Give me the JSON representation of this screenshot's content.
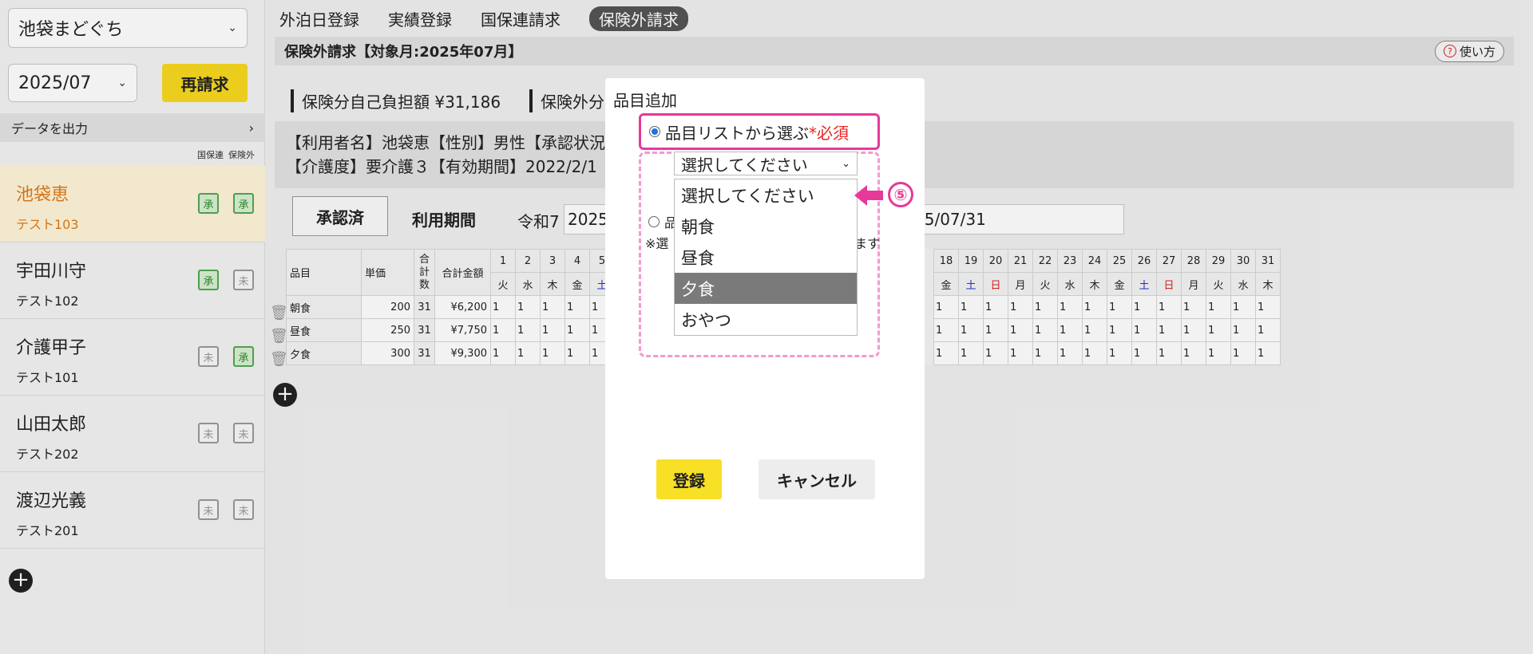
{
  "sidebar": {
    "facility": "池袋まどぐち",
    "month": "2025/07",
    "reclaim_label": "再請求",
    "export_label": "データを出力",
    "export_chevron": "›",
    "col_heads": [
      "国保連",
      "保険外"
    ],
    "users": [
      {
        "name": "池袋恵",
        "sub": "テスト103",
        "b1": "承",
        "b2": "承",
        "b1_on": true,
        "b2_on": true,
        "active": true
      },
      {
        "name": "宇田川守",
        "sub": "テスト102",
        "b1": "承",
        "b2": "未",
        "b1_on": true,
        "b2_on": false,
        "active": false
      },
      {
        "name": "介護甲子",
        "sub": "テスト101",
        "b1": "未",
        "b2": "承",
        "b1_on": false,
        "b2_on": true,
        "active": false
      },
      {
        "name": "山田太郎",
        "sub": "テスト202",
        "b1": "未",
        "b2": "未",
        "b1_on": false,
        "b2_on": false,
        "active": false
      },
      {
        "name": "渡辺光義",
        "sub": "テスト201",
        "b1": "未",
        "b2": "未",
        "b1_on": false,
        "b2_on": false,
        "active": false
      }
    ]
  },
  "tabs": [
    "外泊日登録",
    "実績登録",
    "国保連請求",
    "保険外請求"
  ],
  "title": "保険外請求【対象月:2025年07月】",
  "help_label": "使い方",
  "summary": [
    "保険分自己負担額 ¥31,186",
    "保険外分"
  ],
  "info": {
    "line1": "【利用者名】池袋恵【性別】男性【承認状況",
    "line2": "【介護度】要介護３【有効期間】2022/2/1"
  },
  "approved_label": "承認済",
  "period_label": "利用期間",
  "era_label": "令和7",
  "date_start": "2025,",
  "date_end": "25/07/31",
  "table": {
    "head_item": "品目",
    "head_price": "単価",
    "head_days": "合計数",
    "head_amount": "合計金額",
    "left_days": [
      "1",
      "2",
      "3",
      "4",
      "5"
    ],
    "left_wk": [
      "火",
      "水",
      "木",
      "金",
      "土"
    ],
    "right_days": [
      "18",
      "19",
      "20",
      "21",
      "22",
      "23",
      "24",
      "25",
      "26",
      "27",
      "28",
      "29",
      "30",
      "31"
    ],
    "right_wk": [
      "金",
      "土",
      "日",
      "月",
      "火",
      "水",
      "木",
      "金",
      "土",
      "日",
      "月",
      "火",
      "水",
      "木"
    ],
    "rows": [
      {
        "item": "朝食",
        "price": "200",
        "days": "31",
        "amount": "¥6,200"
      },
      {
        "item": "昼食",
        "price": "250",
        "days": "31",
        "amount": "¥7,750"
      },
      {
        "item": "夕食",
        "price": "300",
        "days": "31",
        "amount": "¥9,300"
      }
    ],
    "cell": "1"
  },
  "modal": {
    "title": "品目追加",
    "radio1_label": "品目リストから選ぶ",
    "required": "*必須",
    "select_value": "選択してください",
    "radio2_partial": "品",
    "note_partial": "※選",
    "note_tail": "ます",
    "options": [
      "選択してください",
      "朝食",
      "昼食",
      "夕食",
      "おやつ"
    ],
    "highlighted": "夕食",
    "register_label": "登録",
    "cancel_label": "キャンセル"
  },
  "callout": "⑤",
  "colors": {
    "accent_yellow": "#f7d81f",
    "callout_pink": "#e8389a",
    "active_orange": "#e07b1a"
  }
}
